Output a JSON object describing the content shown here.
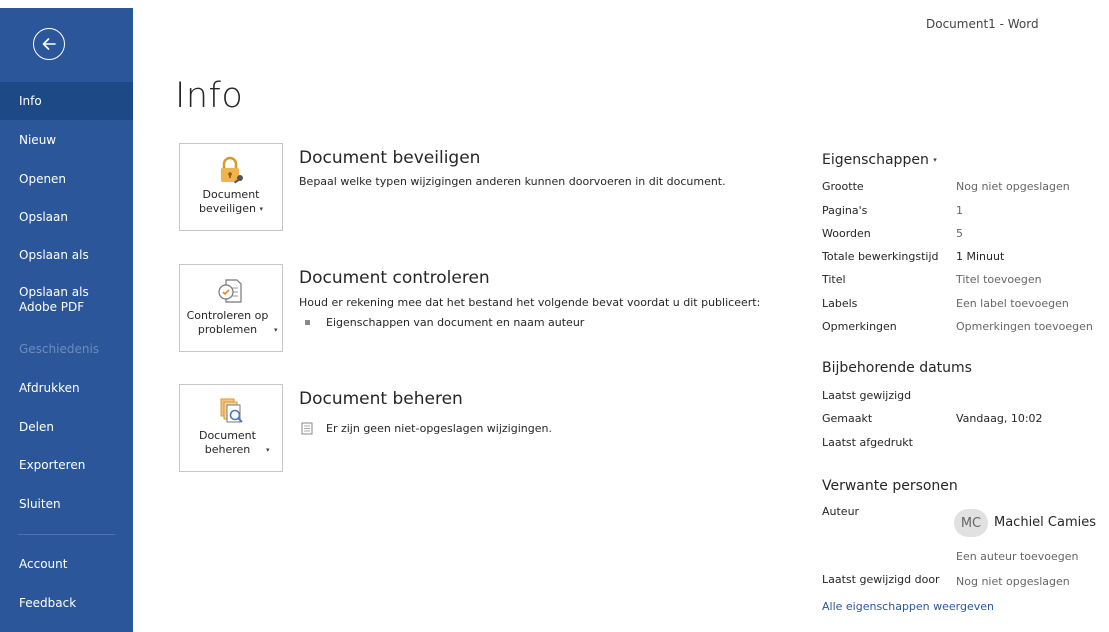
{
  "window": {
    "title": "Document1 - Word"
  },
  "sidebar": {
    "items": [
      {
        "label": "Info",
        "state": "active"
      },
      {
        "label": "Nieuw"
      },
      {
        "label": "Openen"
      },
      {
        "label": "Opslaan"
      },
      {
        "label": "Opslaan als"
      },
      {
        "label": "Opslaan als Adobe PDF"
      },
      {
        "label": "Geschiedenis",
        "state": "disabled"
      },
      {
        "label": "Afdrukken"
      },
      {
        "label": "Delen"
      },
      {
        "label": "Exporteren"
      },
      {
        "label": "Sluiten"
      },
      {
        "label": "Account"
      },
      {
        "label": "Feedback"
      }
    ]
  },
  "main": {
    "title": "Info",
    "sections": [
      {
        "tile_label": "Document beveiligen",
        "title": "Document beveiligen",
        "description": "Bepaal welke typen wijzigingen anderen kunnen doorvoeren in dit document.",
        "icon": "lock-key-icon"
      },
      {
        "tile_label": "Controleren op problemen",
        "title": "Document controleren",
        "description": "Houd er rekening mee dat het bestand het volgende bevat voordat u dit publiceert:",
        "bullet": "Eigenschappen van document en naam auteur",
        "icon": "inspect-document-icon"
      },
      {
        "tile_label": "Document beheren",
        "title": "Document beheren",
        "note": "Er zijn geen niet-opgeslagen wijzigingen.",
        "icon": "manage-document-icon"
      }
    ]
  },
  "properties": {
    "heading": "Eigenschappen",
    "rows": [
      {
        "label": "Grootte",
        "value": "Nog niet opgeslagen"
      },
      {
        "label": "Pagina's",
        "value": "1"
      },
      {
        "label": "Woorden",
        "value": "5"
      },
      {
        "label": "Totale bewerkingstijd",
        "value": "1 Minuut"
      },
      {
        "label": "Titel",
        "value": "Titel toevoegen"
      },
      {
        "label": "Labels",
        "value": "Een label toevoegen"
      },
      {
        "label": "Opmerkingen",
        "value": "Opmerkingen toevoegen"
      }
    ],
    "dates_heading": "Bijbehorende datums",
    "dates": [
      {
        "label": "Laatst gewijzigd",
        "value": ""
      },
      {
        "label": "Gemaakt",
        "value": "Vandaag, 10:02"
      },
      {
        "label": "Laatst afgedrukt",
        "value": ""
      }
    ],
    "people_heading": "Verwante personen",
    "author_label": "Auteur",
    "author_initials": "MC",
    "author_name": "Machiel Camies",
    "add_author": "Een auteur toevoegen",
    "last_modified_by_label": "Laatst gewijzigd door",
    "last_modified_by_value": "Nog niet opgeslagen",
    "show_all_link": "Alle eigenschappen weergeven"
  },
  "colors": {
    "sidebar": "#2b579a",
    "sidebar_active": "#1e4987",
    "lock": "#f0b44c",
    "link": "#2b579a"
  }
}
